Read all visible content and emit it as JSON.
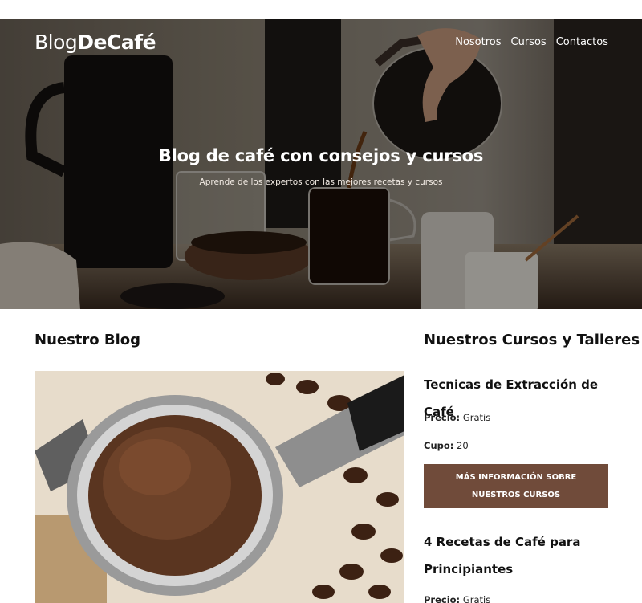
{
  "header": {
    "logo_light": "Blog",
    "logo_bold": "DeCafé",
    "nav": [
      {
        "label": "Nosotros"
      },
      {
        "label": "Cursos"
      },
      {
        "label": "Contactos"
      }
    ]
  },
  "hero": {
    "title": "Blog de café con consejos y cursos",
    "subtitle": "Aprende de los expertos con las mejores recetas y cursos"
  },
  "blog": {
    "heading": "Nuestro Blog"
  },
  "courses": {
    "heading": "Nuestros Cursos y Talleres",
    "price_label": "Precio:",
    "seats_label": "Cupo:",
    "button_label": "Más información sobre nuestros cursos",
    "items": [
      {
        "title": "Tecnicas de Extracción de Café",
        "price": "Gratis",
        "seats": "20"
      },
      {
        "title": "4 Recetas de Café para Principiantes",
        "price": "Gratis"
      }
    ]
  },
  "colors": {
    "button_bg": "#704b3a",
    "hero_overlay": "rgba(0,0,0,0.38)"
  }
}
